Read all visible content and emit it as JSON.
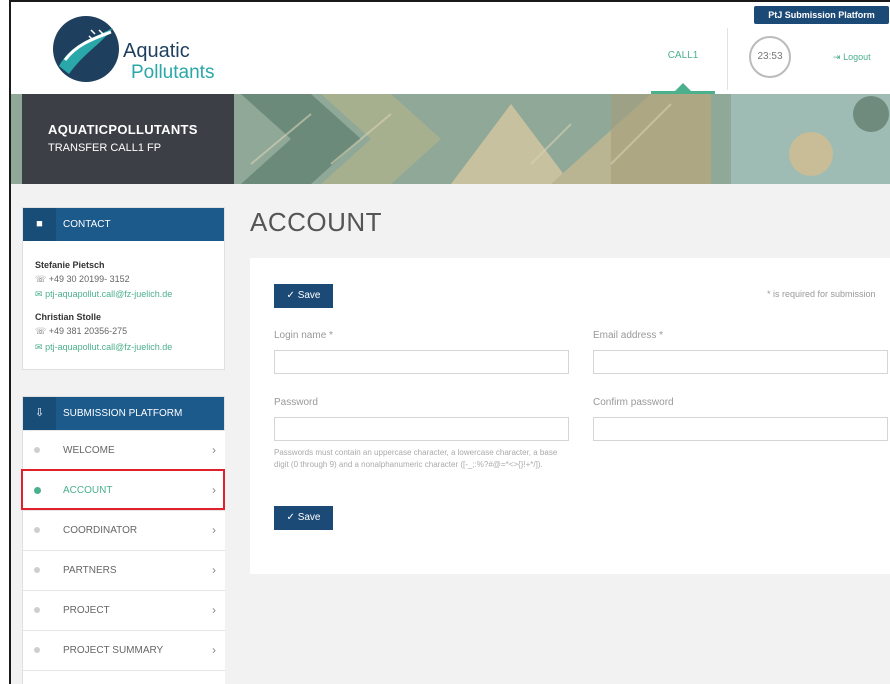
{
  "header": {
    "platform_tab": "PtJ Submission Platform",
    "logo_line1": "Aquatic",
    "logo_line2": "Pollutants",
    "nav_call": "CALL1",
    "timer": "23:53",
    "logout": "Logout"
  },
  "banner": {
    "title": "AQUATICPOLLUTANTS",
    "subtitle": "TRANSFER CALL1 FP"
  },
  "contact": {
    "heading": "CONTACT",
    "people": [
      {
        "name": "Stefanie Pietsch",
        "phone": "+49 30 20199- 3152",
        "email": "ptj-aquapollut.call@fz-juelich.de"
      },
      {
        "name": "Christian Stolle",
        "phone": "+49 381 20356-275",
        "email": "ptj-aquapollut.call@fz-juelich.de"
      }
    ]
  },
  "submission": {
    "heading": "SUBMISSION PLATFORM",
    "items": [
      {
        "label": "WELCOME",
        "active": false
      },
      {
        "label": "ACCOUNT",
        "active": true
      },
      {
        "label": "COORDINATOR",
        "active": false
      },
      {
        "label": "PARTNERS",
        "active": false
      },
      {
        "label": "PROJECT",
        "active": false
      },
      {
        "label": "PROJECT SUMMARY",
        "active": false
      }
    ]
  },
  "main": {
    "title": "ACCOUNT",
    "save_label": "Save",
    "required_note": "* is required for submission",
    "fields": {
      "login_name": "Login name *",
      "email": "Email address *",
      "password": "Password",
      "confirm_password": "Confirm password"
    },
    "password_hint": "Passwords must contain an uppercase character, a lowercase character, a base digit (0 through 9) and a nonalphanumeric character ([-_;:%?#@=*<>{}!+*/]).",
    "values": {
      "login_name": "",
      "email": "",
      "password": "",
      "confirm_password": ""
    }
  },
  "colors": {
    "primary": "#1c4a77",
    "accent": "#4bb08b",
    "highlight": "#e0202c"
  }
}
